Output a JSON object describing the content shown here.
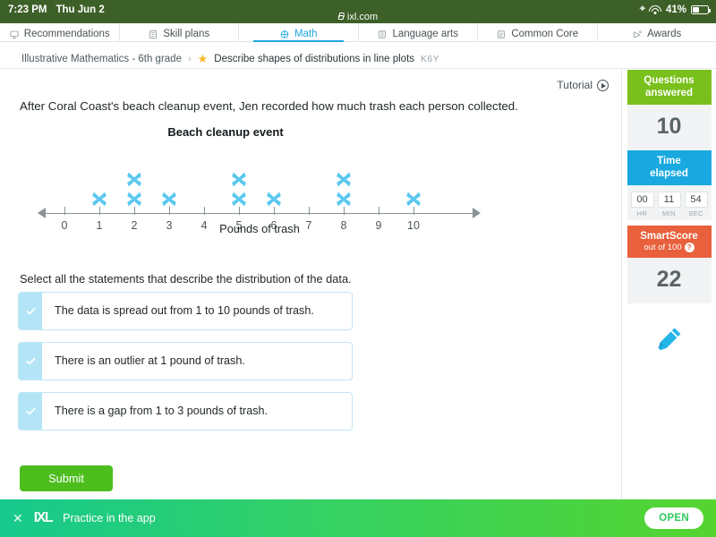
{
  "status_bar": {
    "time": "7:23 PM",
    "date": "Thu Jun 2",
    "location_icon": "location-arrow-icon",
    "wifi_icon": "wifi-icon",
    "battery_percent": "41%",
    "battery_icon": "battery-icon",
    "url": "ixl.com",
    "lock_icon": "lock-icon",
    "bar_color": "#3d6028"
  },
  "nav": {
    "tabs": [
      {
        "label": "Recommendations",
        "icon": "recommendations-icon",
        "active": false
      },
      {
        "label": "Skill plans",
        "icon": "skill-plans-icon",
        "active": false
      },
      {
        "label": "Math",
        "icon": "math-icon",
        "active": true
      },
      {
        "label": "Language arts",
        "icon": "language-arts-icon",
        "active": false
      },
      {
        "label": "Common Core",
        "icon": "common-core-icon",
        "active": false
      },
      {
        "label": "Awards",
        "icon": "awards-icon",
        "active": false
      }
    ],
    "active_color": "#1fa7dd"
  },
  "breadcrumb": {
    "course": "Illustrative Mathematics - 6th grade",
    "separator": "›",
    "star_icon": "star-icon",
    "skill": "Describe shapes of distributions in line plots",
    "skill_code": "K6Y"
  },
  "main": {
    "tutorial_label": "Tutorial",
    "tutorial_icon": "play-circle-icon",
    "question": "After Coral Coast's beach cleanup event, Jen recorded how much trash each person collected.",
    "prompt": "Select all the statements that describe the distribution of the data.",
    "submit_label": "Submit",
    "choices": [
      {
        "text": "The data is spread out from 1 to 10 pounds of trash.",
        "checked": true
      },
      {
        "text": "There is an outlier at 1 pound of trash.",
        "checked": true
      },
      {
        "text": "There is a gap from 1 to 3 pounds of trash.",
        "checked": true
      }
    ],
    "check_icon": "check-icon"
  },
  "chart_data": {
    "type": "scatter",
    "title": "Beach cleanup event",
    "xlabel": "Pounds of trash",
    "ylabel": "",
    "categories": [
      "0",
      "1",
      "2",
      "3",
      "4",
      "5",
      "6",
      "7",
      "8",
      "9",
      "10"
    ],
    "values": [
      0,
      1,
      2,
      1,
      0,
      2,
      1,
      0,
      2,
      0,
      1
    ],
    "x": [
      0,
      1,
      2,
      3,
      4,
      5,
      6,
      7,
      8,
      9,
      10
    ],
    "xlim": [
      0,
      10
    ],
    "marker": "x",
    "marker_color": "#5bc8f0",
    "grid": false,
    "legend": null,
    "axis_color": "#8a9396",
    "notes": "Line plot (dot plot) using X marks; counts stack vertically above each tick."
  },
  "sidebar": {
    "questions": {
      "title_line1": "Questions",
      "title_line2": "answered",
      "value": "10",
      "color": "#7ac01c"
    },
    "time": {
      "title_line1": "Time",
      "title_line2": "elapsed",
      "color": "#19a9e0",
      "hours": "00",
      "minutes": "11",
      "seconds": "54",
      "hr_label": "HR",
      "min_label": "MIN",
      "sec_label": "SEC"
    },
    "smartscore": {
      "title": "SmartScore",
      "subtitle": "out of 100",
      "help_icon": "question-mark-icon",
      "value": "22",
      "color": "#e8603c"
    },
    "pencil_icon": "pencil-icon"
  },
  "app_banner": {
    "close_icon": "close-icon",
    "logo": "IXL",
    "text": "Practice in the app",
    "button_label": "OPEN",
    "gradient_start": "#16c98d",
    "gradient_end": "#55d42f"
  }
}
